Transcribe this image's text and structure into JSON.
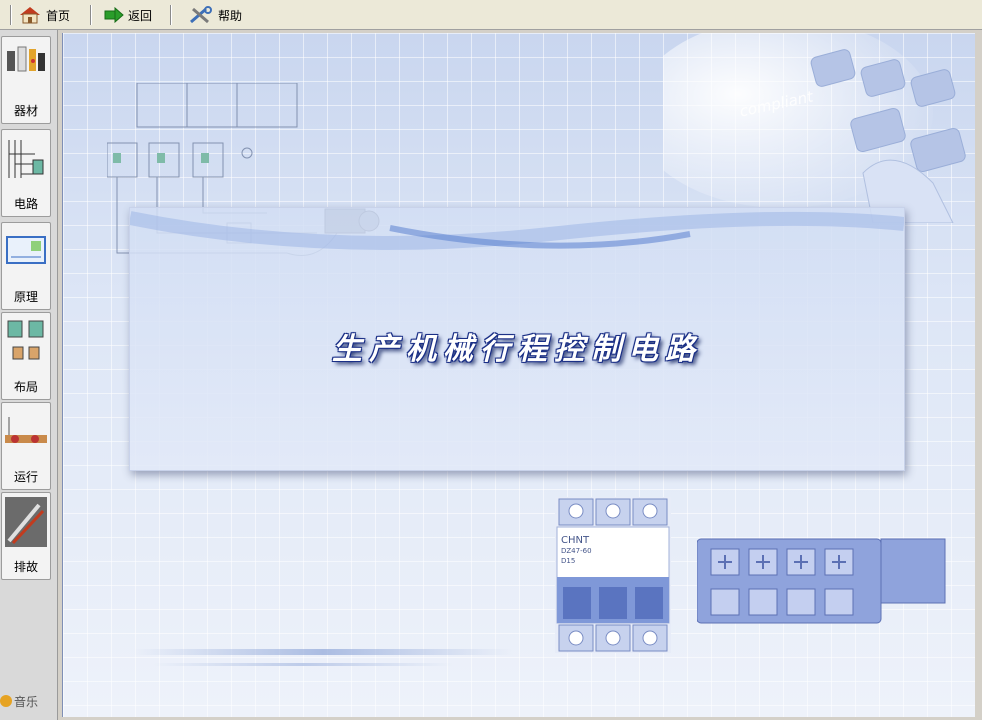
{
  "toolbar": {
    "home_label": "首页",
    "back_label": "返回",
    "help_label": "帮助"
  },
  "sidebar": {
    "items": [
      {
        "label": "器材",
        "icon": "equipment-icon"
      },
      {
        "label": "电路",
        "icon": "circuit-icon"
      },
      {
        "label": "原理",
        "icon": "principle-icon"
      },
      {
        "label": "布局",
        "icon": "layout-icon"
      },
      {
        "label": "运行",
        "icon": "run-icon"
      },
      {
        "label": "排故",
        "icon": "troubleshoot-icon"
      }
    ],
    "music_label": "音乐"
  },
  "stage": {
    "title": "生产机械行程控制电路",
    "decor_text": "compliant",
    "breaker_brand": "CHNT",
    "breaker_model": "DZ47-60",
    "breaker_rating": "D15"
  },
  "colors": {
    "accent": "#1a2f86",
    "stage_bg": "#dde6f6"
  }
}
